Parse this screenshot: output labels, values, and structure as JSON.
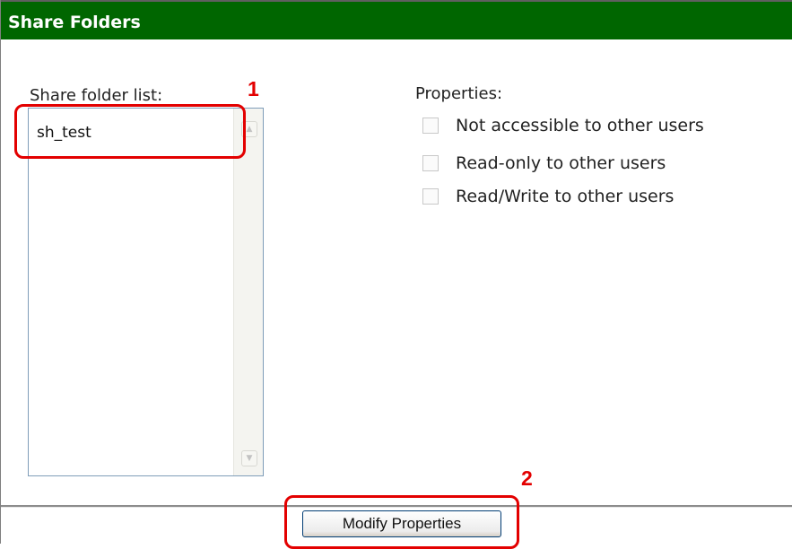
{
  "panel": {
    "title": "Share Folders"
  },
  "share_list": {
    "label": "Share folder list:",
    "items": [
      "sh_test"
    ]
  },
  "properties": {
    "label": "Properties:",
    "options": [
      {
        "label": "Not accessible to other users",
        "checked": false
      },
      {
        "label": "Read-only to other users",
        "checked": false
      },
      {
        "label": "Read/Write to other users",
        "checked": false
      }
    ]
  },
  "actions": {
    "modify_label": "Modify Properties"
  },
  "annotations": {
    "marker_1": "1",
    "marker_2": "2",
    "color": "#e30000"
  },
  "colors": {
    "title_bar": "#006600",
    "title_text": "#ffffff"
  }
}
